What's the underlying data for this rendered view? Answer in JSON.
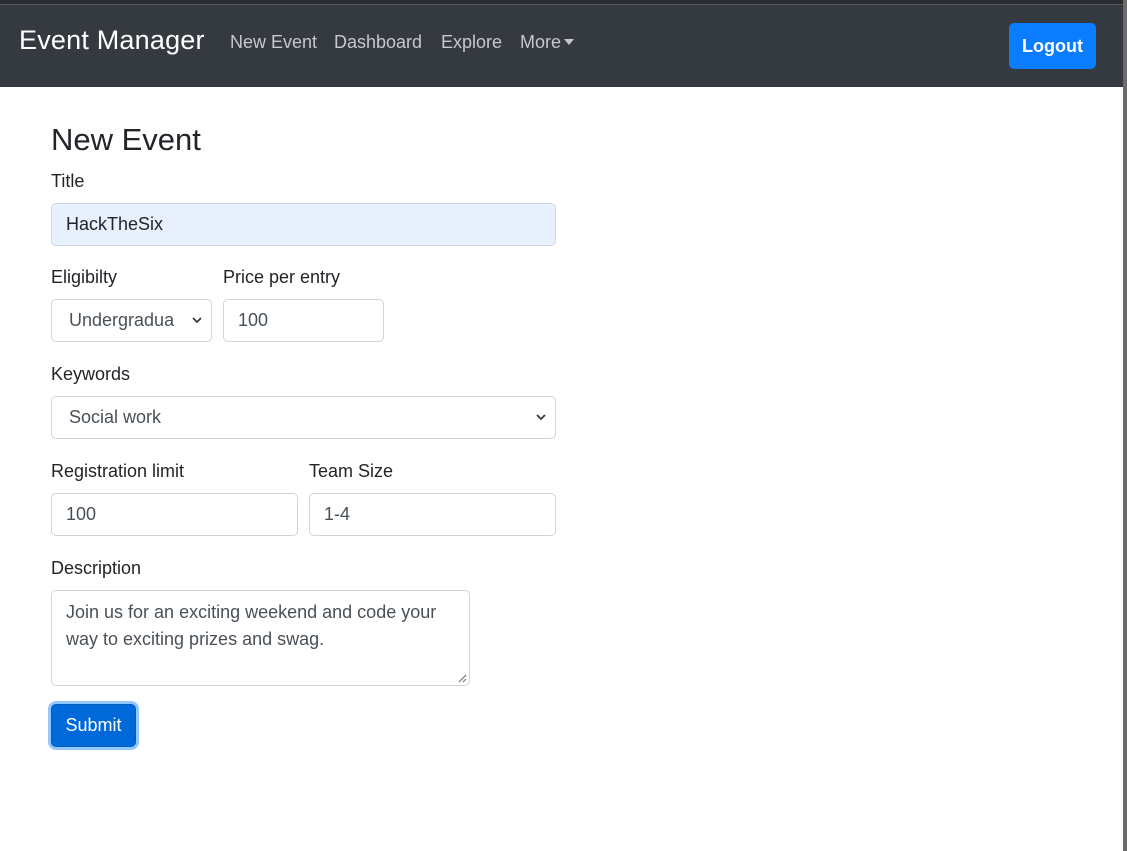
{
  "navbar": {
    "brand": "Event Manager",
    "links": [
      "New Event",
      "Dashboard",
      "Explore",
      "More"
    ],
    "logout_label": "Logout"
  },
  "form": {
    "heading": "New Event",
    "title_label": "Title",
    "title_value": "HackTheSix",
    "eligibility_label": "Eligibilty",
    "eligibility_value": "Undergradua",
    "price_label": "Price per entry",
    "price_value": "100",
    "keywords_label": "Keywords",
    "keywords_value": "Social work",
    "reg_limit_label": "Registration limit",
    "reg_limit_value": "100",
    "team_size_label": "Team Size",
    "team_size_value": "1-4",
    "description_label": "Description",
    "description_value": "Join us for an exciting weekend and code your way to exciting prizes and swag.",
    "submit_label": "Submit"
  },
  "colors": {
    "navbar_bg": "#343a40",
    "primary": "#0a7cff",
    "autofill_bg": "#e8f0fe"
  }
}
